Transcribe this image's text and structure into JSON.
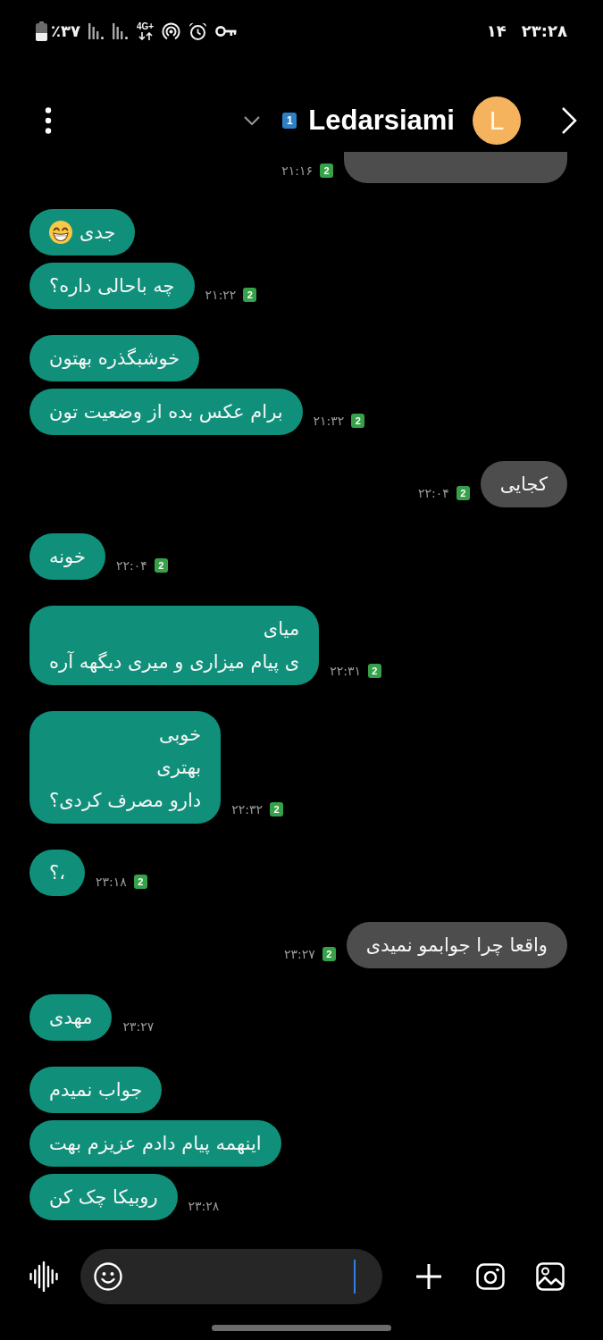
{
  "status_bar": {
    "battery_percent": "٪۳۷",
    "network_type": "4G+",
    "number": "۱۴",
    "time": "۲۳:۲۸"
  },
  "header": {
    "sim": "1",
    "contact_name": "Ledarsiami",
    "avatar_letter": "L"
  },
  "groups": [
    {
      "kind": "received",
      "messages": [
        {
          "cut_off": true
        }
      ],
      "time": "۲۱:۱۶",
      "sim": "2"
    },
    {
      "kind": "sent",
      "messages": [
        {
          "text": "جدی",
          "emoji": true,
          "cut_off": false
        },
        {
          "text": "چه باحالی داره؟",
          "cut_off": false
        }
      ],
      "time": "۲۱:۲۲",
      "sim": "2"
    },
    {
      "kind": "sent",
      "messages": [
        {
          "text": "خوشبگذره بهتون",
          "cut_off": false
        },
        {
          "text": "برام عکس بده از وضعیت تون",
          "cut_off": false
        }
      ],
      "time": "۲۱:۳۲",
      "sim": "2"
    },
    {
      "kind": "received",
      "messages": [
        {
          "text": "کجایی",
          "cut_off": false
        }
      ],
      "time": "۲۲:۰۴",
      "sim": "2"
    },
    {
      "kind": "sent",
      "messages": [
        {
          "text": "خونه",
          "cut_off": false
        }
      ],
      "time": "۲۲:۰۴",
      "sim": "2"
    },
    {
      "kind": "sent",
      "messages": [
        {
          "text": "میای\nی پیام میزاری و میری دیگهه آره",
          "cut_off": false
        }
      ],
      "time": "۲۲:۳۱",
      "sim": "2"
    },
    {
      "kind": "sent",
      "messages": [
        {
          "text": "خوبی\nبهتری\nدارو مصرف کردی؟",
          "cut_off": false
        }
      ],
      "time": "۲۲:۳۲",
      "sim": "2"
    },
    {
      "kind": "sent",
      "messages": [
        {
          "text": "،؟",
          "cut_off": false
        }
      ],
      "time": "۲۳:۱۸",
      "sim": "2"
    },
    {
      "kind": "received",
      "messages": [
        {
          "text": "واقعا چرا جوابمو نمیدی",
          "cut_off": false
        }
      ],
      "time": "۲۳:۲۷",
      "sim": "2"
    },
    {
      "kind": "sent",
      "messages": [
        {
          "text": "مهدی",
          "cut_off": false
        }
      ],
      "time": "۲۳:۲۷"
    },
    {
      "kind": "sent",
      "messages": [
        {
          "text": "جواب نمیدم",
          "cut_off": false
        },
        {
          "text": "اینهمه پیام دادم عزیزم بهت",
          "cut_off": false
        },
        {
          "text": "روبیکا چک کن",
          "cut_off": false
        }
      ],
      "time": "۲۳:۲۸"
    }
  ],
  "composer": {
    "focused": true
  }
}
